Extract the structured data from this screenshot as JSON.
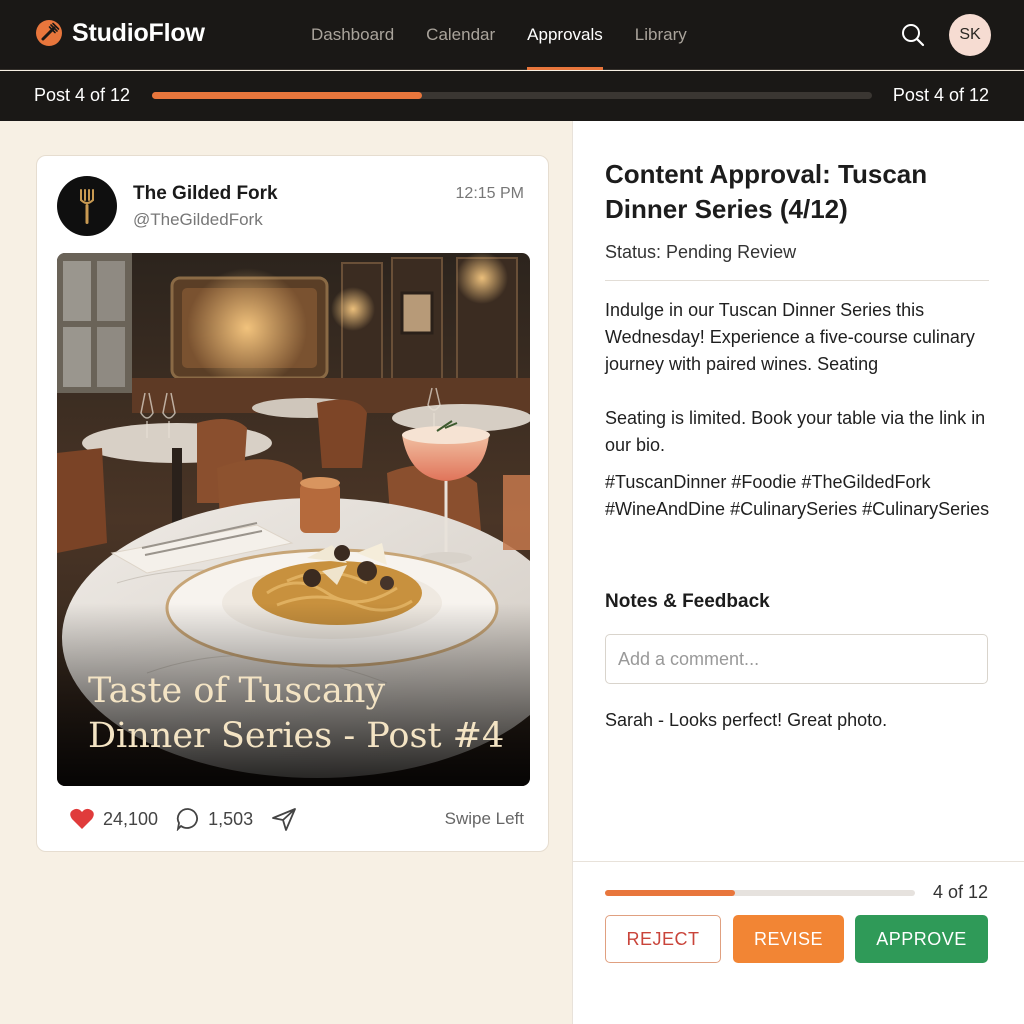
{
  "app": {
    "name": "StudioFlow",
    "logo_icon": "fork-logo-icon"
  },
  "nav": {
    "links": [
      "Dashboard",
      "Calendar",
      "Approvals",
      "Library"
    ],
    "active": "Approvals",
    "avatar_initials": "SK"
  },
  "progress": {
    "left_label": "Post 4 of 12",
    "right_label": "Post 4 of 12",
    "fraction": 0.375
  },
  "post": {
    "account_name": "The Gilded Fork",
    "handle": "@TheGildedFork",
    "time": "12:15 PM",
    "image_caption": "Taste of Tuscany Dinner Series - Post #4",
    "likes": "24,100",
    "comments": "1,503",
    "swipe_hint": "Swipe Left"
  },
  "review": {
    "title": "Content Approval: Tuscan Dinner Series (4/12)",
    "status": "Status: Pending Review",
    "caption_p1": "Indulge in our Tuscan Dinner Series this Wednesday! Experience a five-course culinary journey with paired wines. Seating",
    "caption_p2": "Seating is limited. Book your table via the link in our bio.",
    "hashtags": "#TuscanDinner #Foodie #TheGildedFork #WineAndDine #CulinarySeries #CulinarySeries",
    "notes_heading": "Notes & Feedback",
    "comment_placeholder": "Add a comment...",
    "existing_comment": "Sarah - Looks perfect! Great photo."
  },
  "footer": {
    "count_label": "4 of 12",
    "progress_fraction": 0.42,
    "reject_label": "REJECT",
    "revise_label": "REVISE",
    "approve_label": "APPROVE"
  },
  "colors": {
    "accent": "#e8763c",
    "approve": "#2f9a58",
    "reject": "#c9443a",
    "nav_bg": "#1a1816"
  }
}
